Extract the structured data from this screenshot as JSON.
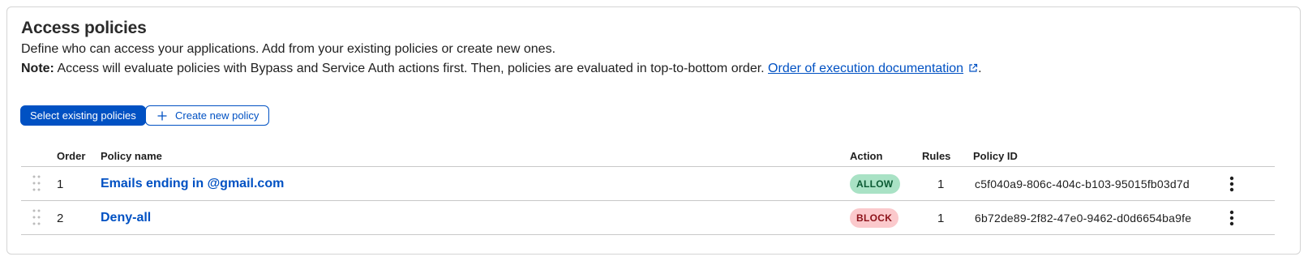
{
  "section": {
    "title": "Access policies",
    "description": "Define who can access your applications. Add from your existing policies or create new ones.",
    "note_label": "Note:",
    "note_text": " Access will evaluate policies with Bypass and Service Auth actions first. Then, policies are evaluated in top-to-bottom order. ",
    "doc_link": "Order of execution documentation",
    "note_end": "."
  },
  "buttons": {
    "select_existing": "Select existing policies",
    "create_new": "Create new policy"
  },
  "table": {
    "headers": {
      "order": "Order",
      "policy_name": "Policy name",
      "action": "Action",
      "rules": "Rules",
      "policy_id": "Policy ID"
    },
    "rows": [
      {
        "order": "1",
        "name": "Emails ending in @gmail.com",
        "action": "ALLOW",
        "rules": "1",
        "policy_id": "c5f040a9-806c-404c-b103-95015fb03d7d"
      },
      {
        "order": "2",
        "name": "Deny-all",
        "action": "BLOCK",
        "rules": "1",
        "policy_id": "6b72de89-2f82-47e0-9462-d0d6654ba9fe"
      }
    ]
  },
  "colors": {
    "brand_blue": "#0051c3",
    "allow_bg": "#a9e2c5",
    "allow_fg": "#0b5a33",
    "block_bg": "#fbc9cc",
    "block_fg": "#8c1119"
  },
  "icons": {
    "external_link": "external-link-icon",
    "plus": "plus-icon",
    "drag_handle": "drag-handle-icon",
    "more_options": "kebab-menu-icon"
  }
}
